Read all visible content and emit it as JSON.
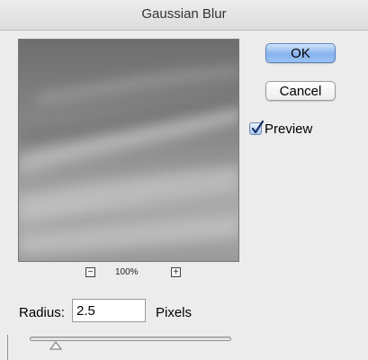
{
  "window": {
    "title": "Gaussian Blur"
  },
  "preview_zoom": {
    "zoom_out_icon": "minus-icon",
    "level": "100%",
    "zoom_in_icon": "plus-icon"
  },
  "radius": {
    "label": "Radius:",
    "value": "2.5",
    "units": "Pixels",
    "slider_position": 0.13
  },
  "buttons": {
    "ok": "OK",
    "cancel": "Cancel"
  },
  "preview_option": {
    "label": "Preview",
    "checked": true
  },
  "colors": {
    "ok_button": "#86b3ee",
    "background": "#ececec",
    "checkbox_check": "#1c2e63"
  }
}
